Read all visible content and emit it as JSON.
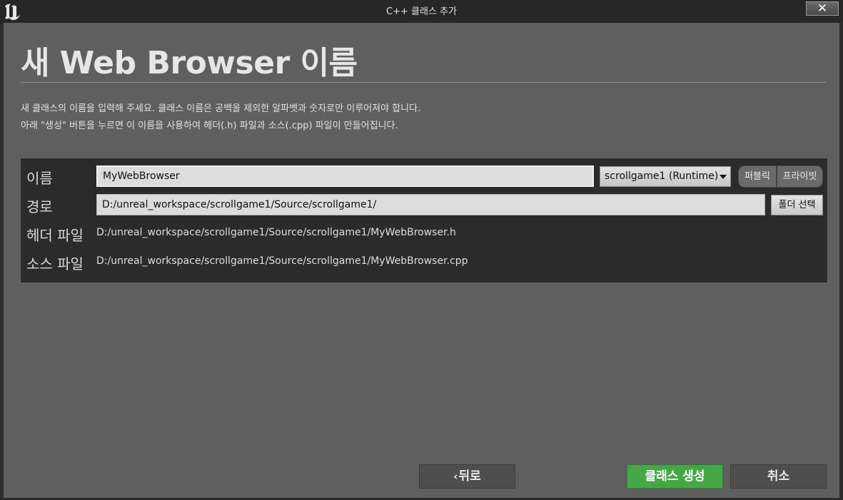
{
  "window": {
    "title": "C++ 클래스 추가",
    "close_label": "✕"
  },
  "header": {
    "title": "새 Web Browser 이름"
  },
  "description": {
    "line1": "새 클래스의 이름을 입력해 주세요. 클래스 이름은 공백을 제외한 알파벳과 숫자로만 이루어져야 합니다.",
    "line2": "아래 \"생성\" 버튼을 누르면 이 이름을 사용하여 헤더(.h) 파일과 소스(.cpp) 파일이 만들어집니다."
  },
  "form": {
    "name_label": "이름",
    "name_value": "MyWebBrowser",
    "module_selected": "scrollgame1 (Runtime)",
    "access_public": "퍼블릭",
    "access_private": "프라이빗",
    "path_label": "경로",
    "path_value": "D:/unreal_workspace/scrollgame1/Source/scrollgame1/",
    "folder_button": "폴더 선택",
    "header_label": "헤더 파일",
    "header_value": "D:/unreal_workspace/scrollgame1/Source/scrollgame1/MyWebBrowser.h",
    "source_label": "소스 파일",
    "source_value": "D:/unreal_workspace/scrollgame1/Source/scrollgame1/MyWebBrowser.cpp"
  },
  "footer": {
    "back_label": "뒤로",
    "create_label": "클래스 생성",
    "cancel_label": "취소"
  },
  "colors": {
    "background": "#5f5f5f",
    "panel": "#2b2b2b",
    "accent_green": "#46a746"
  }
}
